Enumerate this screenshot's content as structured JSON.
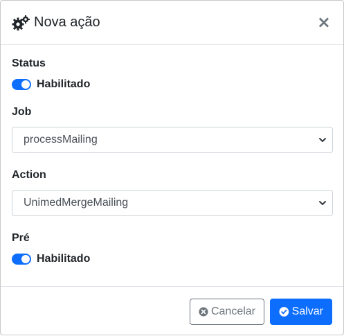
{
  "header": {
    "title": "Nova ação",
    "close_label": "×"
  },
  "fields": {
    "status": {
      "label": "Status",
      "switch_label": "Habilitado",
      "enabled": true
    },
    "job": {
      "label": "Job",
      "value": "processMailing"
    },
    "action": {
      "label": "Action",
      "value": "UnimedMergeMailing"
    },
    "pre": {
      "label": "Pré",
      "switch_label": "Habilitado",
      "enabled": true
    }
  },
  "footer": {
    "cancel_label": "Cancelar",
    "save_label": "Salvar"
  },
  "colors": {
    "primary": "#0d6efd",
    "secondary": "#6c757d"
  },
  "icons": {
    "title": "cogs-icon",
    "cancel": "times-circle-icon",
    "save": "check-circle-icon"
  }
}
